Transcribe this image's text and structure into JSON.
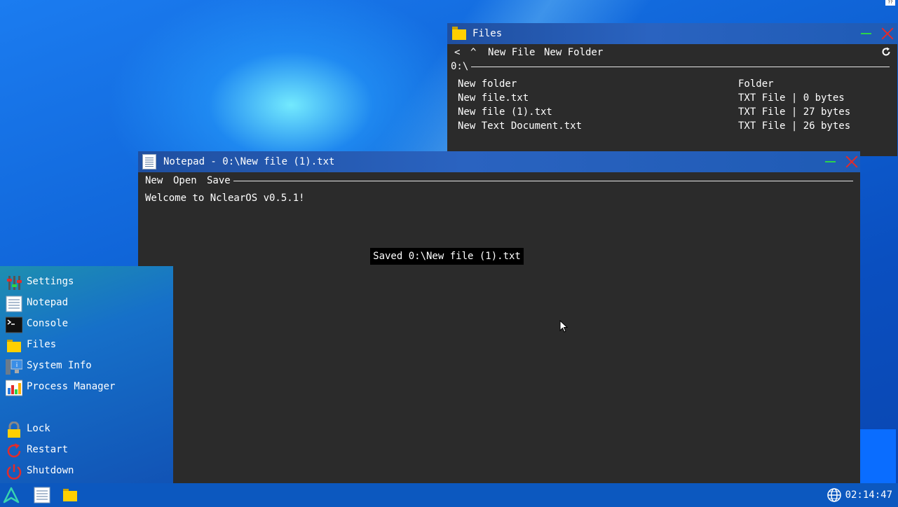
{
  "files_window": {
    "title": "Files",
    "toolbar": {
      "back": "<",
      "up": "^",
      "new_file": "New File",
      "new_folder": "New Folder",
      "refresh_icon": "refresh-icon"
    },
    "path": "0:\\",
    "entries": [
      {
        "name": "New folder",
        "type": "Folder"
      },
      {
        "name": "New file.txt",
        "type": "TXT File | 0 bytes"
      },
      {
        "name": "New file (1).txt",
        "type": "TXT File | 27 bytes"
      },
      {
        "name": "New Text Document.txt",
        "type": "TXT File | 26 bytes"
      }
    ]
  },
  "notepad_window": {
    "title": "Notepad - 0:\\New file (1).txt",
    "menu": {
      "new": "New",
      "open": "Open",
      "save": "Save"
    },
    "content": "Welcome to NclearOS v0.5.1!",
    "toast": "Saved 0:\\New file (1).txt"
  },
  "start_menu": {
    "apps": [
      {
        "label": "Settings",
        "icon": "settings-icon"
      },
      {
        "label": "Notepad",
        "icon": "notepad-icon"
      },
      {
        "label": "Console",
        "icon": "console-icon"
      },
      {
        "label": "Files",
        "icon": "folder-icon"
      },
      {
        "label": "System Info",
        "icon": "system-info-icon"
      },
      {
        "label": "Process Manager",
        "icon": "process-manager-icon"
      }
    ],
    "power": [
      {
        "label": "Lock",
        "icon": "lock-icon"
      },
      {
        "label": "Restart",
        "icon": "restart-icon"
      },
      {
        "label": "Shutdown",
        "icon": "shutdown-icon"
      }
    ]
  },
  "taskbar": {
    "clock": "02:14:47",
    "network_icon": "globe-icon"
  },
  "corner_tag": "??",
  "colors": {
    "window_bg": "#2b2b2b",
    "titlebar": "#2a63c0",
    "close": "#e32b2b",
    "minimize": "#2bd44a",
    "folder": "#ffd000",
    "taskbar": "#0c58bf"
  }
}
